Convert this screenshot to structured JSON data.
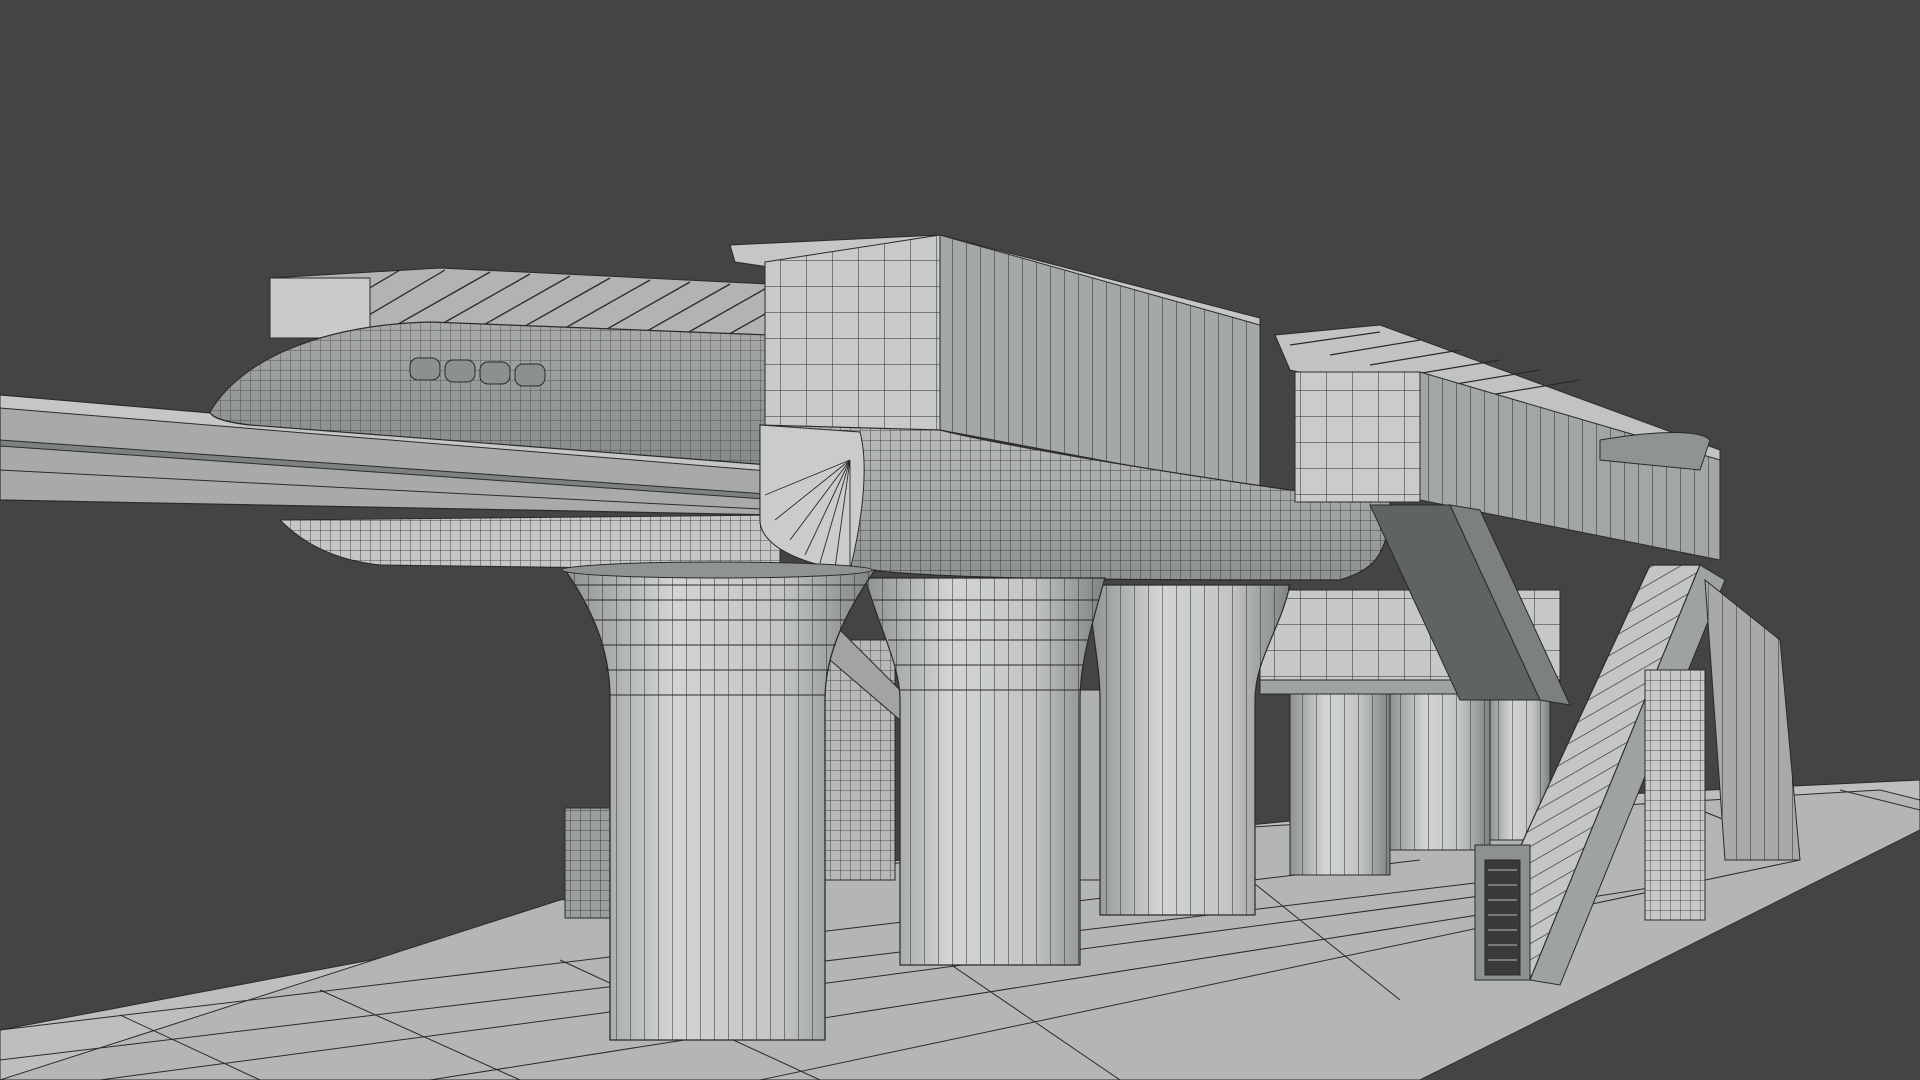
{
  "viewport": {
    "background_color": "#444444",
    "shading": "solid-gray-with-wireframe",
    "wireframe_color": "#222222",
    "surface_light": "#c9cccb",
    "surface_mid": "#a9acab",
    "surface_dark": "#5f6363",
    "ground_color": "#b8bbba"
  }
}
